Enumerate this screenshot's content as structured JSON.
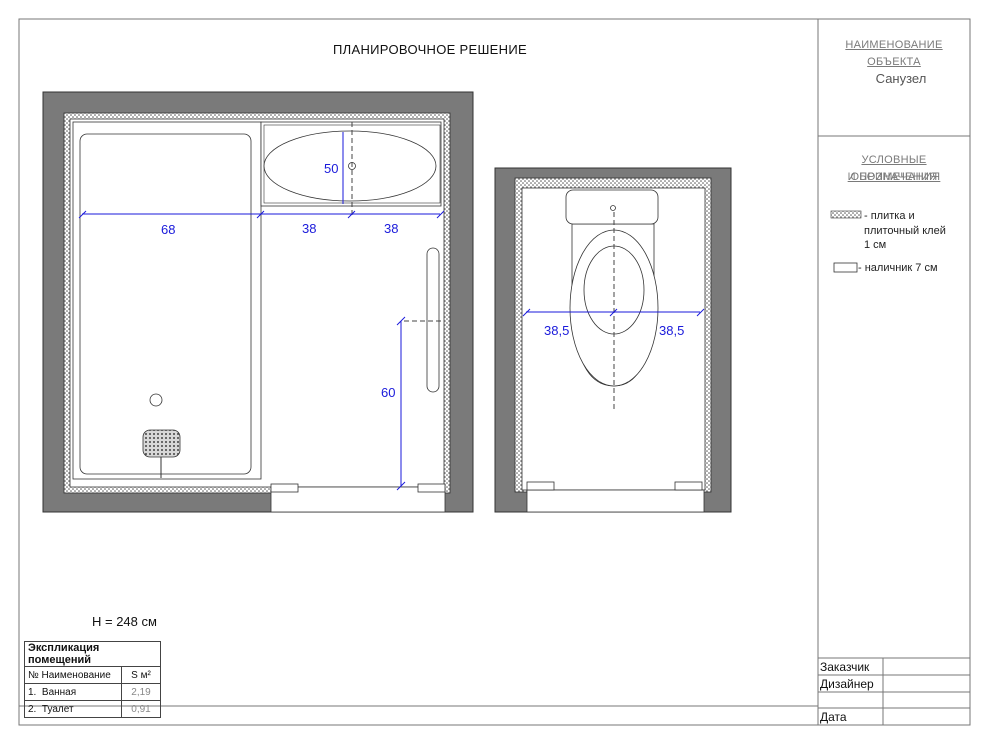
{
  "title": "ПЛАНИРОВОЧНОЕ  РЕШЕНИЕ",
  "side_panel": {
    "object_heading": "НАИМЕНОВАНИЕ ОБЪЕКТА",
    "object_name": "Санузел",
    "legend_heading_1": "УСЛОВНЫЕ ОБОЗНАЧЕНИЯ",
    "legend_heading_2": "И ПРИМЕЧАНИЯ",
    "legend": [
      {
        "line1": "- плитка и",
        "line2": "плиточный клей",
        "line3": "1 см"
      },
      {
        "line1": "- наличник 7 см"
      }
    ]
  },
  "height_note": "H = 248 см",
  "bathroom": {
    "dims": {
      "sink_depth": "50",
      "bath_width": "68",
      "left_to_sink": "38",
      "sink_to_right": "38",
      "towel_height": "60"
    }
  },
  "toilet_room": {
    "dims": {
      "left": "38,5",
      "right": "38,5"
    }
  },
  "explication": {
    "title": "Экспликация помещений",
    "col_num_name": "№ Наименование",
    "col_area": "S  м²",
    "rows": [
      {
        "num": "1.",
        "name": "Ванная",
        "area": "2,19"
      },
      {
        "num": "2.",
        "name": "Туалет",
        "area": "0,91"
      }
    ]
  },
  "stamp": {
    "customer_label": "Заказчик",
    "designer_label": "Дизайнер",
    "date_label": "Дата"
  },
  "colors": {
    "dimension": "#1a1adb",
    "wall": "#7a7a7a",
    "tile": "#cfcfcf"
  }
}
